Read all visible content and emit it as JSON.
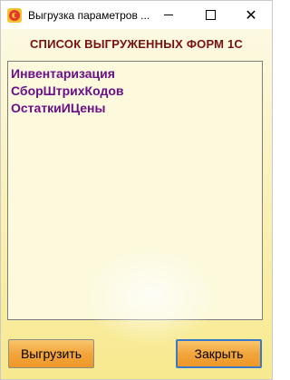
{
  "window": {
    "title": "Выгрузка параметров ...",
    "controls": {
      "minimize": "minimize",
      "maximize": "maximize",
      "close": "✕"
    }
  },
  "main": {
    "heading": "СПИСОК ВЫГРУЖЕННЫХ ФОРМ 1С",
    "items": [
      "Инвентаризация",
      "СборШтрихКодов",
      "ОстаткиИЦены"
    ]
  },
  "buttons": {
    "export_label": "Выгрузить",
    "close_label": "Закрыть"
  },
  "colors": {
    "heading": "#7a1010",
    "list_text": "#6d0f87",
    "button": "#f2a53c"
  }
}
